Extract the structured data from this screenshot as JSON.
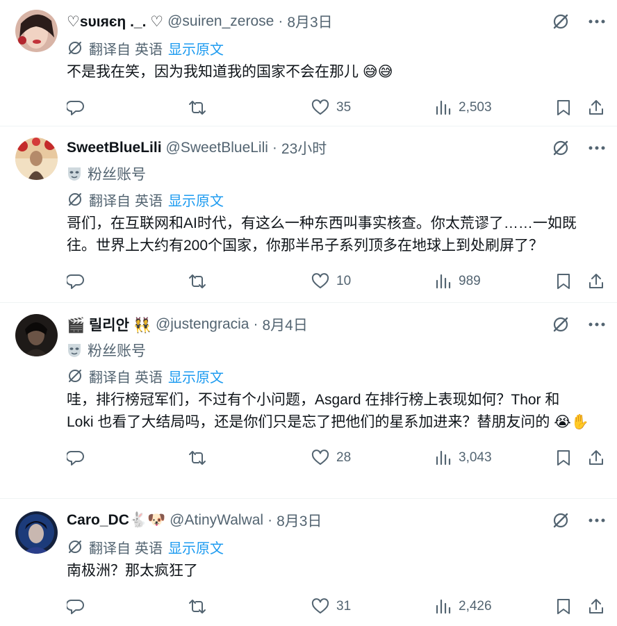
{
  "replies": [
    {
      "name": "♡ѕυιяєη ._. ♡",
      "handle": "@suiren_zerose",
      "time": "8月3日",
      "fan_label": "",
      "translate": {
        "label": "翻译自",
        "lang": "英语",
        "show": "显示原文"
      },
      "text": "不是我在笑，因为我知道我的国家不会在那儿 😅😅",
      "stats": {
        "replies": "",
        "retweets": "",
        "likes": "35",
        "views": "2,503"
      }
    },
    {
      "name": "SweetBlueLili",
      "handle": "@SweetBlueLili",
      "time": "23小时",
      "fan_label": "粉丝账号",
      "translate": {
        "label": "翻译自",
        "lang": "英语",
        "show": "显示原文"
      },
      "text": "哥们，在互联网和AI时代，有这么一种东西叫事实核查。你太荒谬了……一如既往。世界上大约有200个国家，你那半吊子系列顶多在地球上到处刷屏了？",
      "stats": {
        "replies": "",
        "retweets": "",
        "likes": "10",
        "views": "989"
      }
    },
    {
      "name": "🎬 릴리안 👯",
      "handle": "@justengracia",
      "time": "8月4日",
      "fan_label": "粉丝账号",
      "translate": {
        "label": "翻译自",
        "lang": "英语",
        "show": "显示原文"
      },
      "text": "哇，排行榜冠军们，不过有个小问题，Asgard 在排行榜上表现如何？Thor 和 Loki 也看了大结局吗，还是你们只是忘了把他们的星系加进来？替朋友问的 😭✋",
      "stats": {
        "replies": "",
        "retweets": "",
        "likes": "28",
        "views": "3,043"
      }
    },
    {
      "name": "Caro_DC🐇🐶",
      "handle": "@AtinyWalwal",
      "time": "8月3日",
      "fan_label": "",
      "translate": {
        "label": "翻译自",
        "lang": "英语",
        "show": "显示原文"
      },
      "text": "南极洲？那太疯狂了",
      "stats": {
        "replies": "",
        "retweets": "",
        "likes": "31",
        "views": "2,426"
      }
    }
  ],
  "colors": {
    "text": "#0f1419",
    "secondary": "#536471",
    "link": "#1d9bf0",
    "divider": "#eff3f4"
  },
  "icons": [
    "grok-icon",
    "more-icon",
    "mask-icon",
    "translate-icon",
    "reply-icon",
    "retweet-icon",
    "like-icon",
    "views-icon",
    "bookmark-icon",
    "share-icon"
  ]
}
